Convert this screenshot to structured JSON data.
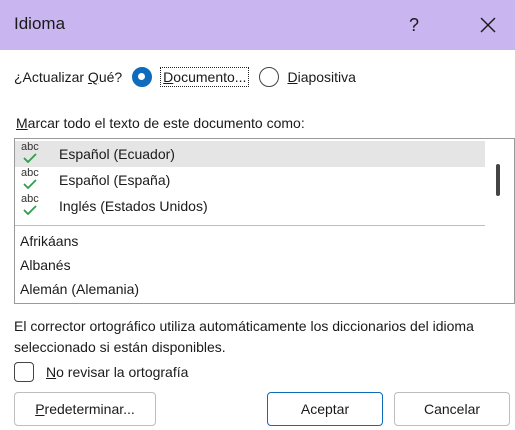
{
  "dialog": {
    "title": "Idioma",
    "help_label": "?"
  },
  "update_what": {
    "label_pre": "¿Actualizar ",
    "label_ul": "Q",
    "label_post": "ué?",
    "options": [
      {
        "label_ul": "D",
        "label_rest": "ocumento...",
        "checked": true
      },
      {
        "label_ul": "D",
        "label_rest": "iapositiva",
        "checked": false
      }
    ]
  },
  "mark_label": {
    "ul": "M",
    "rest": "arcar todo el texto de este documento como:"
  },
  "languages": {
    "checked": [
      {
        "label": "Español (Ecuador)",
        "selected": true,
        "icon": "abc-spellcheck-icon",
        "abc": "abc"
      },
      {
        "label": "Español (España)",
        "selected": false,
        "icon": "abc-spellcheck-icon",
        "abc": "abc"
      },
      {
        "label": "Inglés (Estados Unidos)",
        "selected": false,
        "icon": "abc-spellcheck-icon",
        "abc": "abc"
      }
    ],
    "others": [
      "Afrikáans",
      "Albanés",
      "Alemán (Alemania)"
    ]
  },
  "info_text": "El corrector ortográfico utiliza automáticamente los diccionarios del idioma seleccionado si están disponibles.",
  "no_check": {
    "ul": "N",
    "rest": "o revisar la ortografía",
    "checked": false
  },
  "buttons": {
    "default_ul": "P",
    "default_rest": "redeterminar...",
    "accept": "Aceptar",
    "cancel": "Cancelar"
  },
  "colors": {
    "titlebar": "#c9b5ef",
    "accent": "#0f6cbd",
    "check_green": "#2e9e4f",
    "selected_row": "#e5e5e5"
  }
}
